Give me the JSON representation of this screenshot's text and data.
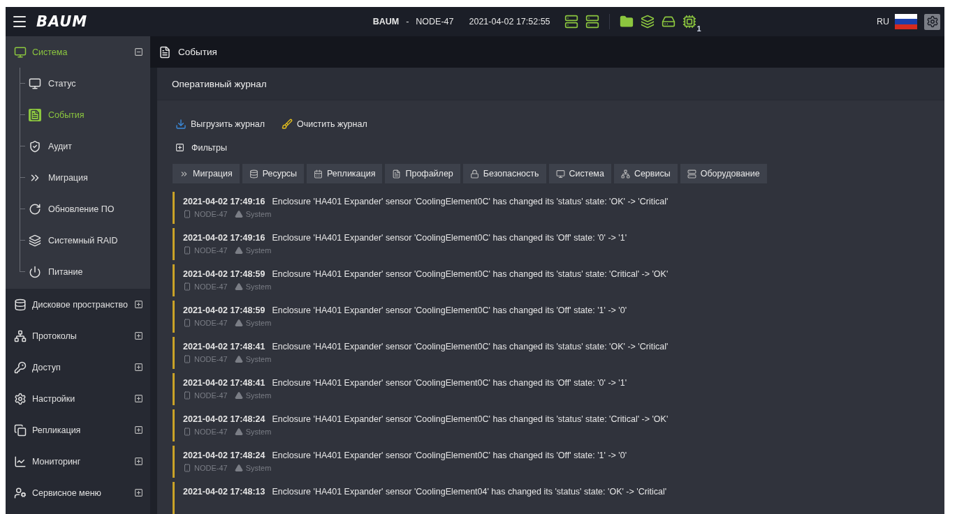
{
  "topbar": {
    "logo": "BAUM",
    "host": "BAUM",
    "separator": "-",
    "node": "NODE-47",
    "datetime": "2021-04-02 17:52:55",
    "chip_count": "1",
    "language": "RU"
  },
  "sidebar": {
    "groups": [
      {
        "label": "Система",
        "expanded": true,
        "selected": true,
        "children": [
          {
            "label": "Статус",
            "selected": false
          },
          {
            "label": "События",
            "selected": true
          },
          {
            "label": "Аудит",
            "selected": false
          },
          {
            "label": "Миграция",
            "selected": false
          },
          {
            "label": "Обновление ПО",
            "selected": false
          },
          {
            "label": "Системный RAID",
            "selected": false
          },
          {
            "label": "Питание",
            "selected": false
          }
        ]
      },
      {
        "label": "Дисковое пространство",
        "expanded": false,
        "selected": false
      },
      {
        "label": "Протоколы",
        "expanded": false,
        "selected": false
      },
      {
        "label": "Доступ",
        "expanded": false,
        "selected": false
      },
      {
        "label": "Настройки",
        "expanded": false,
        "selected": false
      },
      {
        "label": "Репликация",
        "expanded": false,
        "selected": false
      },
      {
        "label": "Мониторинг",
        "expanded": false,
        "selected": false
      },
      {
        "label": "Сервисное меню",
        "expanded": false,
        "selected": false
      }
    ]
  },
  "page": {
    "title": "События",
    "panel_title": "Оперативный журнал",
    "actions": [
      "Выгрузить журнал",
      "Очистить журнал"
    ],
    "filters": {
      "label": "Фильтры",
      "expanded": false
    },
    "tags": [
      "Миграция",
      "Ресурсы",
      "Репликация",
      "Профайлер",
      "Безопасность",
      "Система",
      "Сервисы",
      "Оборудование"
    ],
    "events": [
      {
        "time": "2021-04-02 17:49:16",
        "message": "Enclosure 'HA401 Expander' sensor 'CoolingElement0C' has changed its 'status' state: 'OK' -> 'Critical'",
        "node": "NODE-47",
        "category": "System"
      },
      {
        "time": "2021-04-02 17:49:16",
        "message": "Enclosure 'HA401 Expander' sensor 'CoolingElement0C' has changed its 'Off' state: '0' -> '1'",
        "node": "NODE-47",
        "category": "System"
      },
      {
        "time": "2021-04-02 17:48:59",
        "message": "Enclosure 'HA401 Expander' sensor 'CoolingElement0C' has changed its 'status' state: 'Critical' -> 'OK'",
        "node": "NODE-47",
        "category": "System"
      },
      {
        "time": "2021-04-02 17:48:59",
        "message": "Enclosure 'HA401 Expander' sensor 'CoolingElement0C' has changed its 'Off' state: '1' -> '0'",
        "node": "NODE-47",
        "category": "System"
      },
      {
        "time": "2021-04-02 17:48:41",
        "message": "Enclosure 'HA401 Expander' sensor 'CoolingElement0C' has changed its 'status' state: 'OK' -> 'Critical'",
        "node": "NODE-47",
        "category": "System"
      },
      {
        "time": "2021-04-02 17:48:41",
        "message": "Enclosure 'HA401 Expander' sensor 'CoolingElement0C' has changed its 'Off' state: '0' -> '1'",
        "node": "NODE-47",
        "category": "System"
      },
      {
        "time": "2021-04-02 17:48:24",
        "message": "Enclosure 'HA401 Expander' sensor 'CoolingElement0C' has changed its 'status' state: 'Critical' -> 'OK'",
        "node": "NODE-47",
        "category": "System"
      },
      {
        "time": "2021-04-02 17:48:24",
        "message": "Enclosure 'HA401 Expander' sensor 'CoolingElement0C' has changed its 'Off' state: '1' -> '0'",
        "node": "NODE-47",
        "category": "System"
      },
      {
        "time": "2021-04-02 17:48:13",
        "message": "Enclosure 'HA401 Expander' sensor 'CoolingElement04' has changed its 'status' state: 'OK' -> 'Critical'"
      }
    ]
  }
}
